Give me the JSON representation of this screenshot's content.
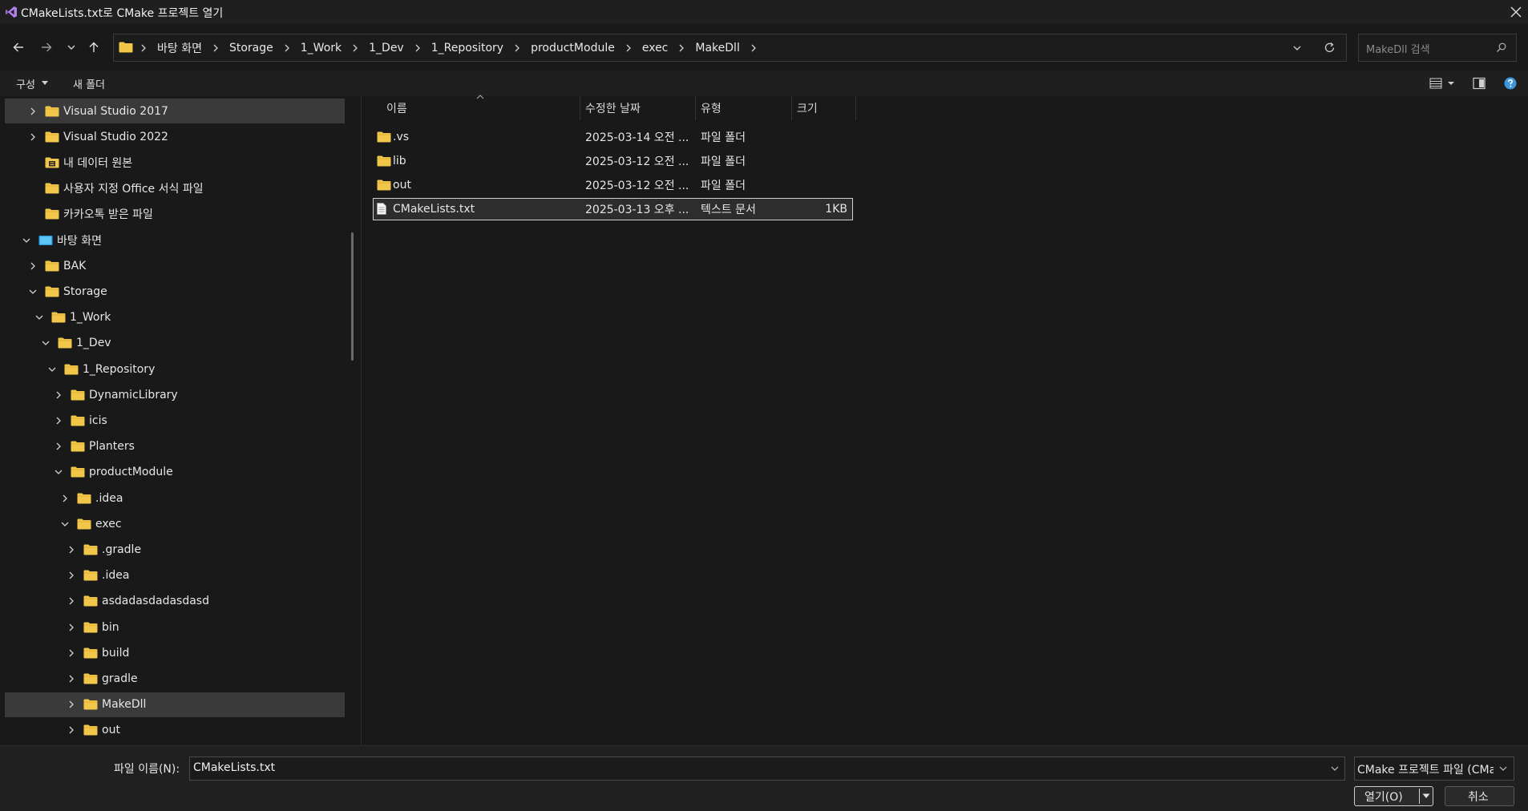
{
  "window": {
    "title": "CMakeLists.txt로 CMake 프로젝트 열기"
  },
  "address": {
    "crumbs": [
      "바탕 화면",
      "Storage",
      "1_Work",
      "1_Dev",
      "1_Repository",
      "productModule",
      "exec",
      "MakeDll"
    ]
  },
  "search": {
    "placeholder": "MakeDll 검색"
  },
  "commands": {
    "organize": "구성",
    "new_folder": "새 폴더"
  },
  "tree": [
    {
      "label": "Visual Studio 2017",
      "level": 1,
      "expander": "collapsed",
      "icon": "folder",
      "selected": true
    },
    {
      "label": "Visual Studio 2022",
      "level": 1,
      "expander": "collapsed",
      "icon": "folder"
    },
    {
      "label": "내 데이터 원본",
      "level": 1,
      "expander": "none",
      "icon": "data-folder"
    },
    {
      "label": "사용자 지정 Office 서식 파일",
      "level": 1,
      "expander": "none",
      "icon": "folder"
    },
    {
      "label": "카카오톡 받은 파일",
      "level": 1,
      "expander": "none",
      "icon": "folder"
    },
    {
      "label": "바탕 화면",
      "level": 0,
      "expander": "expanded",
      "icon": "desktop"
    },
    {
      "label": "BAK",
      "level": 1,
      "expander": "collapsed",
      "icon": "folder"
    },
    {
      "label": "Storage",
      "level": 1,
      "expander": "expanded",
      "icon": "folder"
    },
    {
      "label": "1_Work",
      "level": 2,
      "expander": "expanded",
      "icon": "folder"
    },
    {
      "label": "1_Dev",
      "level": 3,
      "expander": "expanded",
      "icon": "folder"
    },
    {
      "label": "1_Repository",
      "level": 4,
      "expander": "expanded",
      "icon": "folder"
    },
    {
      "label": "DynamicLibrary",
      "level": 5,
      "expander": "collapsed",
      "icon": "folder"
    },
    {
      "label": "icis",
      "level": 5,
      "expander": "collapsed",
      "icon": "folder"
    },
    {
      "label": "Planters",
      "level": 5,
      "expander": "collapsed",
      "icon": "folder"
    },
    {
      "label": "productModule",
      "level": 5,
      "expander": "expanded",
      "icon": "folder"
    },
    {
      "label": ".idea",
      "level": 6,
      "expander": "collapsed",
      "icon": "folder"
    },
    {
      "label": "exec",
      "level": 6,
      "expander": "expanded",
      "icon": "folder"
    },
    {
      "label": ".gradle",
      "level": 7,
      "expander": "collapsed",
      "icon": "folder"
    },
    {
      "label": ".idea",
      "level": 7,
      "expander": "collapsed",
      "icon": "folder"
    },
    {
      "label": "asdadasdadasdasd",
      "level": 7,
      "expander": "collapsed",
      "icon": "folder"
    },
    {
      "label": "bin",
      "level": 7,
      "expander": "collapsed",
      "icon": "folder"
    },
    {
      "label": "build",
      "level": 7,
      "expander": "collapsed",
      "icon": "folder"
    },
    {
      "label": "gradle",
      "level": 7,
      "expander": "collapsed",
      "icon": "folder"
    },
    {
      "label": "MakeDll",
      "level": 7,
      "expander": "collapsed",
      "icon": "folder",
      "selected": true
    },
    {
      "label": "out",
      "level": 7,
      "expander": "collapsed",
      "icon": "folder"
    }
  ],
  "list": {
    "columns": {
      "name": "이름",
      "date": "수정한 날짜",
      "type": "유형",
      "size": "크기"
    },
    "rows": [
      {
        "name": ".vs",
        "date": "2025-03-14 오전 ...",
        "type": "파일 폴더",
        "size": "",
        "icon": "folder"
      },
      {
        "name": "lib",
        "date": "2025-03-12 오전 ...",
        "type": "파일 폴더",
        "size": "",
        "icon": "folder"
      },
      {
        "name": "out",
        "date": "2025-03-12 오전 ...",
        "type": "파일 폴더",
        "size": "",
        "icon": "folder"
      },
      {
        "name": "CMakeLists.txt",
        "date": "2025-03-13 오후 ...",
        "type": "텍스트 문서",
        "size": "1KB",
        "icon": "text-file",
        "selected": true
      }
    ]
  },
  "footer": {
    "filename_label": "파일 이름(N):",
    "filename_value": "CMakeLists.txt",
    "filter_value": "CMake 프로젝트 파일 (CMakeLists.txt)",
    "open_label": "열기(O)",
    "cancel_label": "취소"
  },
  "colors": {
    "background": "#191919",
    "folder": "#f2c649",
    "accent": "#3a96dd"
  }
}
